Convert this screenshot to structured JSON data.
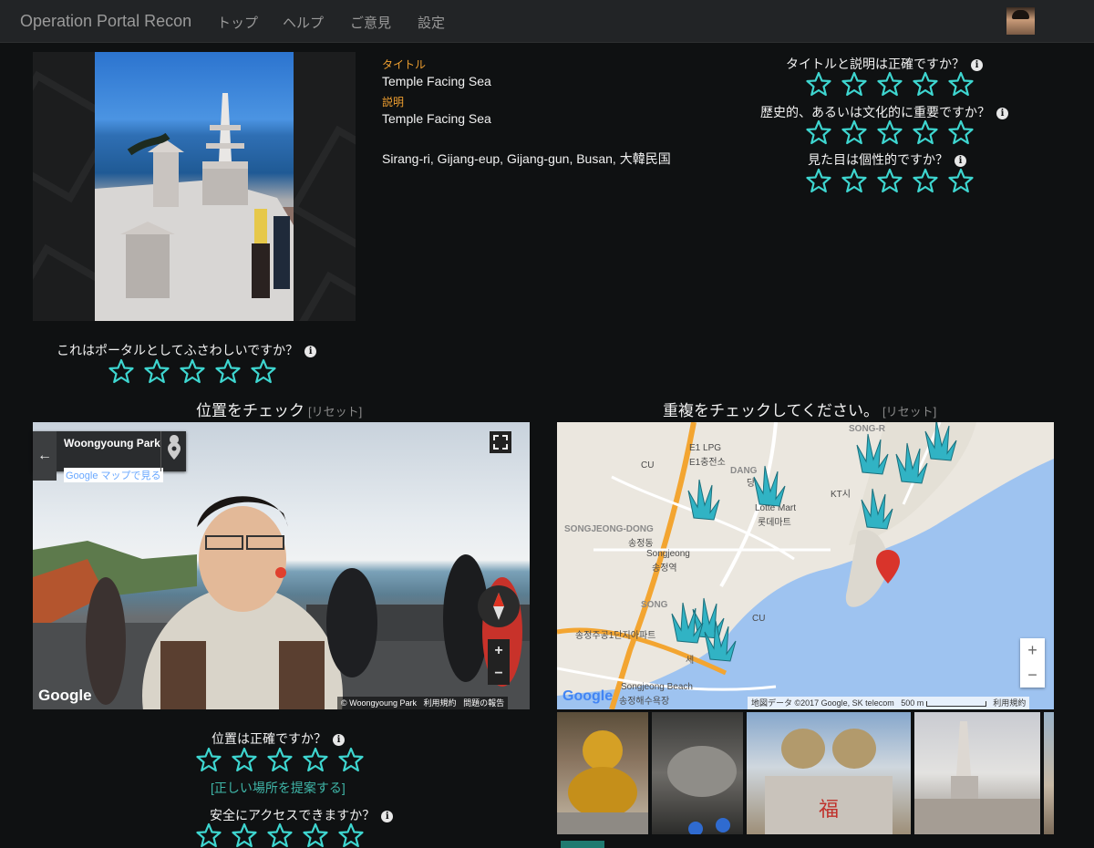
{
  "nav": {
    "brand": "Operation Portal Recon",
    "links": [
      "トップ",
      "ヘルプ",
      "ご意見",
      "設定"
    ]
  },
  "portal": {
    "title_label": "タイトル",
    "title": "Temple Facing Sea",
    "description_label": "説明",
    "description": "Temple Facing Sea",
    "address": "Sirang-ri, Gijang-eup, Gijang-gun, Busan, 大韓民国"
  },
  "ratings": {
    "stars_per_question": 5,
    "q_title": "タイトルと説明は正確ですか？",
    "q_history": "歴史的、あるいは文化的に重要ですか？",
    "q_unique": "見た目は個性的ですか？",
    "q_portal": "これはポータルとしてふさわしいですか？",
    "q_location": "位置は正確ですか？",
    "q_safe": "安全にアクセスできますか？",
    "info_glyph": "i",
    "star_color": "#3ed6d0"
  },
  "location": {
    "title": "位置をチェック",
    "reset": "[リセット]",
    "suggest": "[正しい場所を提案する]",
    "streetview": {
      "place_name": "Woongyoung Park",
      "maps_link": "Google マップで見る",
      "credit": "© Woongyoung Park",
      "terms": "利用規約",
      "report": "問題の報告",
      "logo": "Google"
    }
  },
  "duplicates": {
    "title": "重複をチェックしてください。",
    "reset": "[リセット]",
    "map": {
      "labels": [
        "E1 LPG",
        "E1충전소",
        "DANG",
        "당",
        "Lotte Mart",
        "롯데마트",
        "KT시",
        "SONGJEONG-DONG",
        "송정동",
        "Songjeong",
        "송정역",
        "CU",
        "CU",
        "송정주공1단지아파트",
        "Songjeong Beach",
        "송정해수욕장",
        "세",
        "SONG-R",
        "SONG"
      ],
      "attribution": "地図データ ©2017 Google, SK telecom",
      "scale": "500 m",
      "terms": "利用規約",
      "logo": "Google",
      "zoom_in": "+",
      "zoom_out": "−"
    },
    "thumbnail_subjects": [
      "golden-buddha",
      "rock-turtle",
      "pig-statues",
      "stone-pagoda",
      "partial"
    ]
  },
  "colors": {
    "accent_orange": "#f0a030",
    "teal_link": "#3fb6a8",
    "star": "#3ed6d0",
    "background": "#0f1112"
  }
}
